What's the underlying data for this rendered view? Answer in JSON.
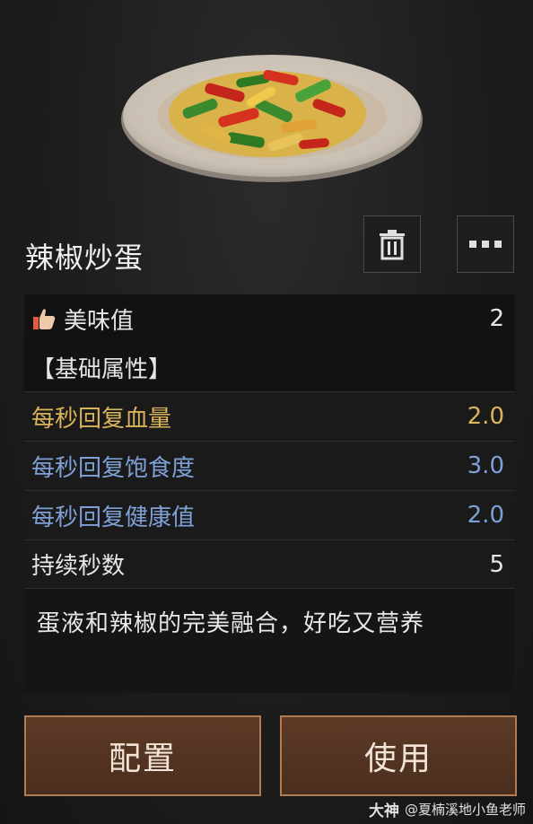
{
  "item": {
    "name": "辣椒炒蛋",
    "description": "蛋液和辣椒的完美融合，好吃又营养"
  },
  "stats": {
    "taste_label": "美味值",
    "taste_value": "2",
    "section_label": "【基础属性】",
    "rows": [
      {
        "label": "每秒回复血量",
        "value": "2.0",
        "color": "#d9b45a"
      },
      {
        "label": "每秒回复饱食度",
        "value": "3.0",
        "color": "#7fa0d6"
      },
      {
        "label": "每秒回复健康值",
        "value": "2.0",
        "color": "#7fa0d6"
      },
      {
        "label": "持续秒数",
        "value": "5",
        "color": "#e6e6e6"
      }
    ]
  },
  "actions": {
    "config_label": "配置",
    "use_label": "使用"
  },
  "icons": {
    "thumb": "thumbs-up-icon",
    "trash": "trash-icon",
    "more": "more-dots-icon"
  },
  "watermark": {
    "logo": "大神",
    "text": "@夏楠溪地小鱼老师"
  }
}
